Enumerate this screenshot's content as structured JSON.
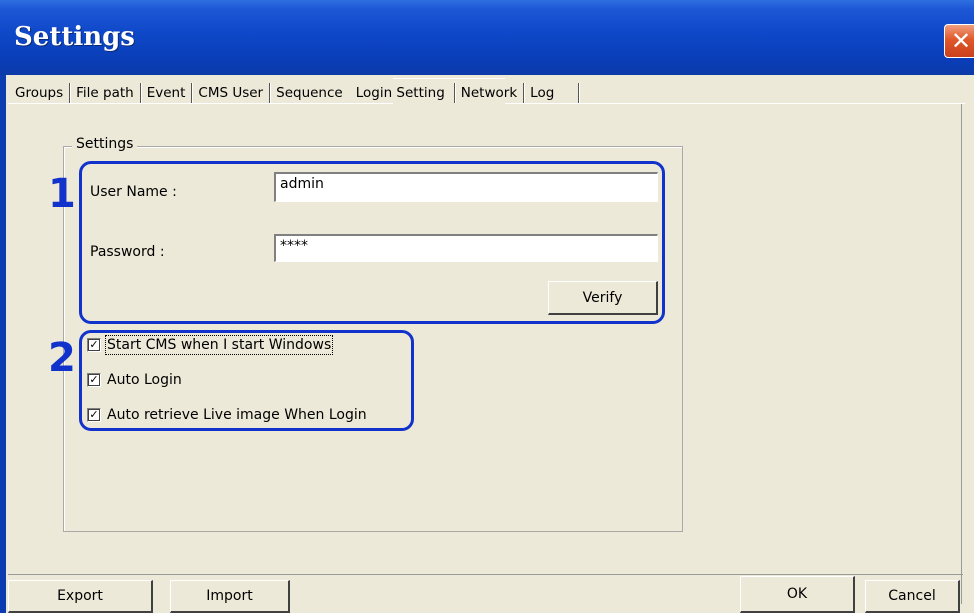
{
  "window": {
    "title": "Settings",
    "close_glyph": "✕"
  },
  "tabs": [
    {
      "label": "Groups"
    },
    {
      "label": "File path"
    },
    {
      "label": "Event"
    },
    {
      "label": "CMS User"
    },
    {
      "label": "Sequence"
    },
    {
      "label": "Login Setting",
      "active": true
    },
    {
      "label": "Network"
    },
    {
      "label": "Log"
    }
  ],
  "settings_group": {
    "legend": "Settings",
    "username_label": "User Name :",
    "username_value": "admin",
    "password_label": "Password :",
    "password_value": "****",
    "verify_button": "Verify"
  },
  "options": [
    {
      "label": "Start CMS when I start Windows",
      "checked": true
    },
    {
      "label": "Auto Login",
      "checked": true
    },
    {
      "label": "Auto retrieve Live image When Login",
      "checked": true
    }
  ],
  "annotations": {
    "marker_1": "1",
    "marker_2": "2",
    "highlight_color": "#1133cc"
  },
  "footer": {
    "export_button": "Export",
    "import_button": "Import",
    "ok_button": "OK",
    "cancel_button": "Cancel"
  },
  "colors": {
    "titlebar": "#0e48c8",
    "dialog_bg": "#ece9d8",
    "close_button": "#e0582a"
  }
}
